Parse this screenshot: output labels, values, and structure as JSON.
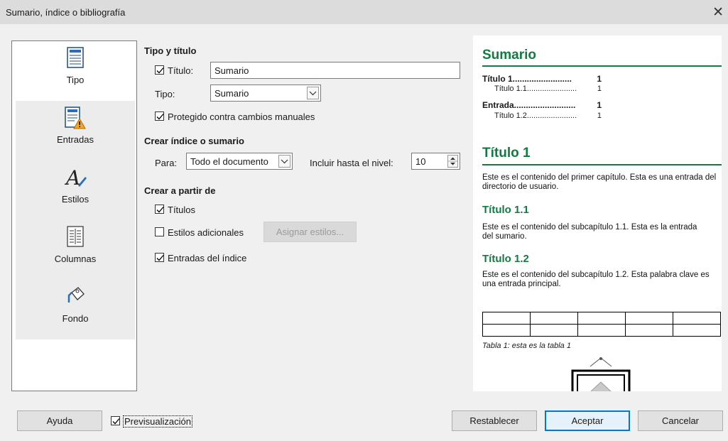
{
  "window": {
    "title": "Sumario, índice o bibliografía",
    "close_glyph": "✕"
  },
  "sidebar": {
    "items": [
      {
        "label": "Tipo",
        "icon": "document-icon"
      },
      {
        "label": "Entradas",
        "icon": "document-warning-icon"
      },
      {
        "label": "Estilos",
        "icon": "styles-icon"
      },
      {
        "label": "Columnas",
        "icon": "columns-icon"
      },
      {
        "label": "Fondo",
        "icon": "paint-bucket-icon"
      }
    ]
  },
  "type_section": {
    "heading": "Tipo y título",
    "title_checkbox_label": "Título:",
    "title_checked": true,
    "title_value": "Sumario",
    "type_label": "Tipo:",
    "type_value": "Sumario",
    "protected_label": "Protegido contra cambios manuales",
    "protected_checked": true
  },
  "create_section": {
    "heading": "Crear índice o sumario",
    "for_label": "Para:",
    "for_value": "Todo el documento",
    "level_label": "Incluir hasta el nivel:",
    "level_value": "10"
  },
  "from_section": {
    "heading": "Crear a partir de",
    "titles_label": "Títulos",
    "titles_checked": true,
    "additional_label": "Estilos adicionales",
    "additional_checked": false,
    "assign_styles_button": "Asignar estilos...",
    "index_entries_label": "Entradas del índice",
    "index_entries_checked": true
  },
  "preview": {
    "heading": "Sumario",
    "toc": [
      {
        "text": "Título 1.........................",
        "page": "1",
        "level": 1
      },
      {
        "text": "Título 1.1.......................",
        "page": "1",
        "level": 2
      },
      {
        "text": "Entrada..........................",
        "page": "1",
        "level": 1
      },
      {
        "text": "Título 1.2.......................",
        "page": "1",
        "level": 2
      }
    ],
    "h1": "Título 1",
    "p1": "Este es el contenido del primer capítulo. Esta es una entrada del directorio de usuario.",
    "h11": "Título 1.1",
    "p11": "Este es el contenido del subcapítulo 1.1. Esta es la entrada del sumario.",
    "h12": "Título 1.2",
    "p12": "Este es el contenido del subcapítulo 1.2. Esta palabra clave es una entrada principal.",
    "table_caption": "Tabla 1: esta es la tabla 1",
    "accent_color": "#107c41"
  },
  "footer": {
    "help_button": "Ayuda",
    "preview_label": "Previsualización",
    "preview_checked": true,
    "reset_button": "Restablecer",
    "ok_button": "Aceptar",
    "cancel_button": "Cancelar"
  }
}
